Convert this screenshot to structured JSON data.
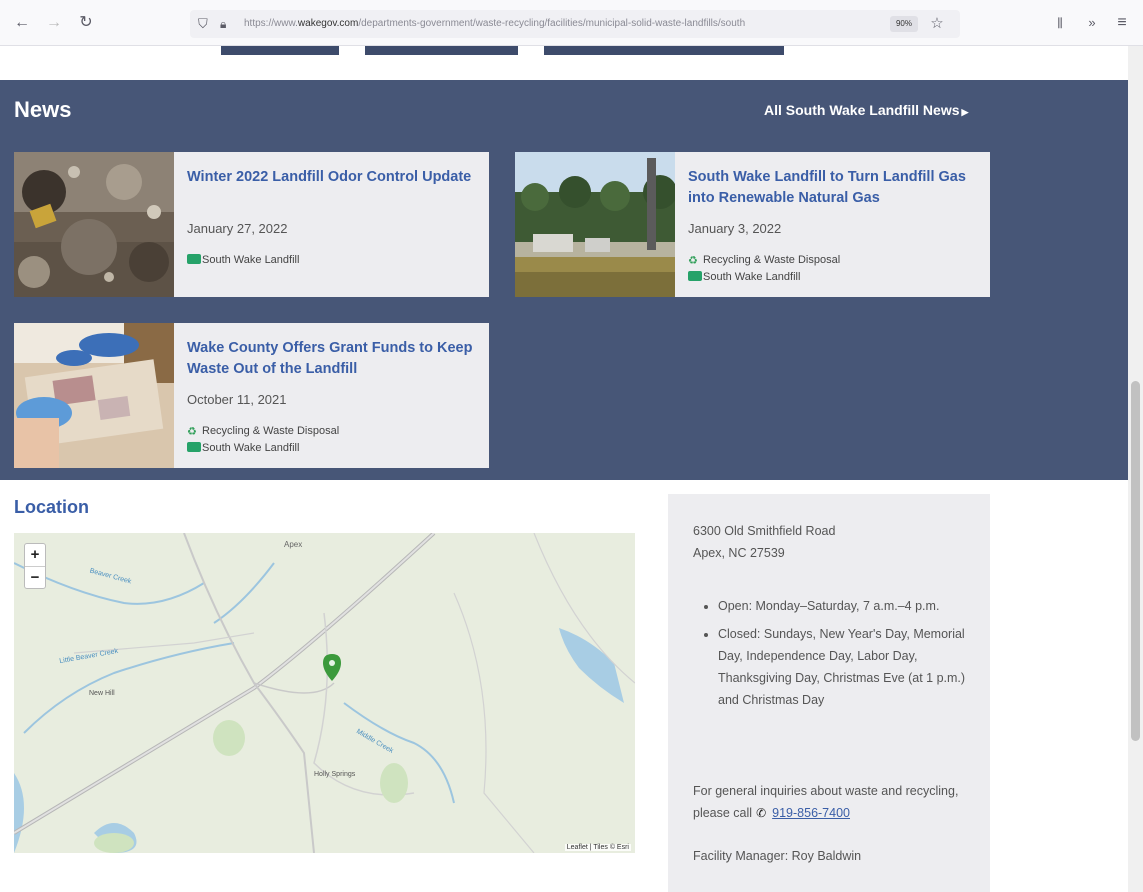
{
  "browser": {
    "url_prefix": "https://www.",
    "url_domain": "wakegov.com",
    "url_path": "/departments-government/waste-recycling/facilities/municipal-solid-waste-landfills/south",
    "zoom": "90%"
  },
  "news": {
    "title": "News",
    "all_link": "All South Wake Landfill News",
    "items": [
      {
        "title": "Winter 2022 Landfill Odor Control Update",
        "date": "January 27, 2022",
        "tags": [
          "South Wake Landfill"
        ]
      },
      {
        "title": "South Wake Landfill to Turn Landfill Gas into Renewable Natural Gas",
        "date": "January 3, 2022",
        "tags": [
          "Recycling & Waste Disposal",
          "South Wake Landfill"
        ]
      },
      {
        "title": "Wake County Offers Grant Funds to Keep Waste Out of the Landfill",
        "date": "October 11, 2021",
        "tags": [
          "Recycling & Waste Disposal",
          "South Wake Landfill"
        ]
      }
    ]
  },
  "location": {
    "title": "Location",
    "map": {
      "zoom_in": "+",
      "zoom_out": "−",
      "attribution": "Leaflet | Tiles © Esri",
      "labels": [
        "Apex",
        "Beaver Creek",
        "Little Beaver Creek",
        "New Hill",
        "Middle Creek",
        "Holly Springs"
      ]
    },
    "address_line1": "6300 Old Smithfield Road",
    "address_line2": "Apex, NC 27539",
    "hours": [
      "Open: Monday–Saturday, 7 a.m.–4 p.m.",
      "Closed: Sundays, New Year's Day, Memorial Day, Independence Day, Labor Day, Thanksgiving Day, Christmas Eve (at 1 p.m.) and Christmas Day"
    ],
    "inquiry_text": "For general inquiries about waste and recycling, please call",
    "phone": "919-856-7400",
    "manager": "Facility Manager: Roy Baldwin"
  }
}
